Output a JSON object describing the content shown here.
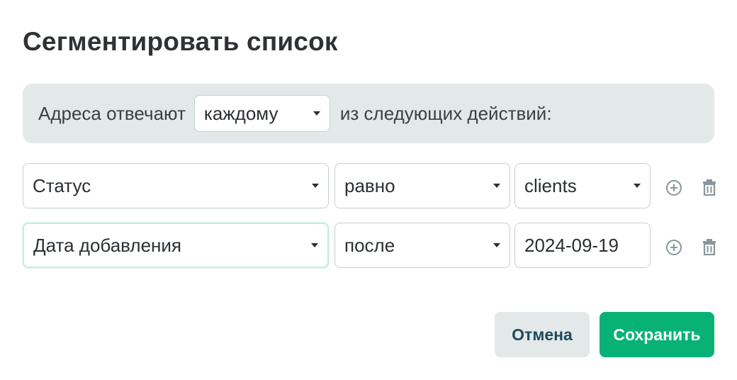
{
  "dialog": {
    "title": "Сегментировать список"
  },
  "match": {
    "prefix": "Адреса отвечают",
    "selected": "каждому",
    "suffix": "из следующих действий:"
  },
  "conditions": [
    {
      "field": "Статус",
      "operator": "равно",
      "value": "clients",
      "value_type": "select"
    },
    {
      "field": "Дата добавления",
      "operator": "после",
      "value": "2024-09-19",
      "value_type": "input"
    }
  ],
  "icons": {
    "add": "plus-circle-icon",
    "delete": "trash-icon"
  },
  "buttons": {
    "cancel": "Отмена",
    "save": "Сохранить"
  },
  "colors": {
    "primary": "#08b277",
    "cancel_text": "#1f4a5e",
    "panel_bg": "#e3e9e8",
    "focus_border": "#c6eedb"
  }
}
